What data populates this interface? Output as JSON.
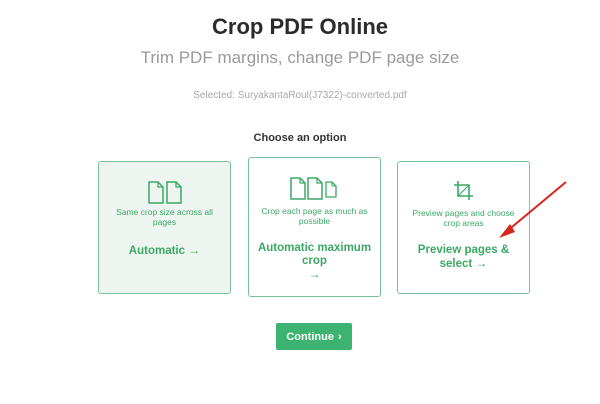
{
  "header": {
    "title": "Crop PDF Online",
    "subtitle": "Trim PDF margins, change PDF page size"
  },
  "file": {
    "selected_text": "Selected: SuryakantaRoul(J7322)-converted.pdf"
  },
  "options": {
    "heading": "Choose an option",
    "items": [
      {
        "description": "Same crop size across all pages",
        "label": "Automatic",
        "arrow": "→",
        "icon": "two-pages-icon",
        "selected": true
      },
      {
        "description": "Crop each page as much as possible",
        "label": "Automatic maximum crop",
        "arrow": "→",
        "icon": "three-pages-icon",
        "selected": false
      },
      {
        "description": "Preview pages and choose crop areas",
        "label": "Preview pages & select",
        "arrow": "→",
        "icon": "crop-icon",
        "selected": false
      }
    ]
  },
  "actions": {
    "continue_label": "Continue",
    "continue_chevron": "›"
  },
  "colors": {
    "accent": "#3cb371",
    "card_border": "#7ac39a",
    "annotation": "#d9261c"
  }
}
